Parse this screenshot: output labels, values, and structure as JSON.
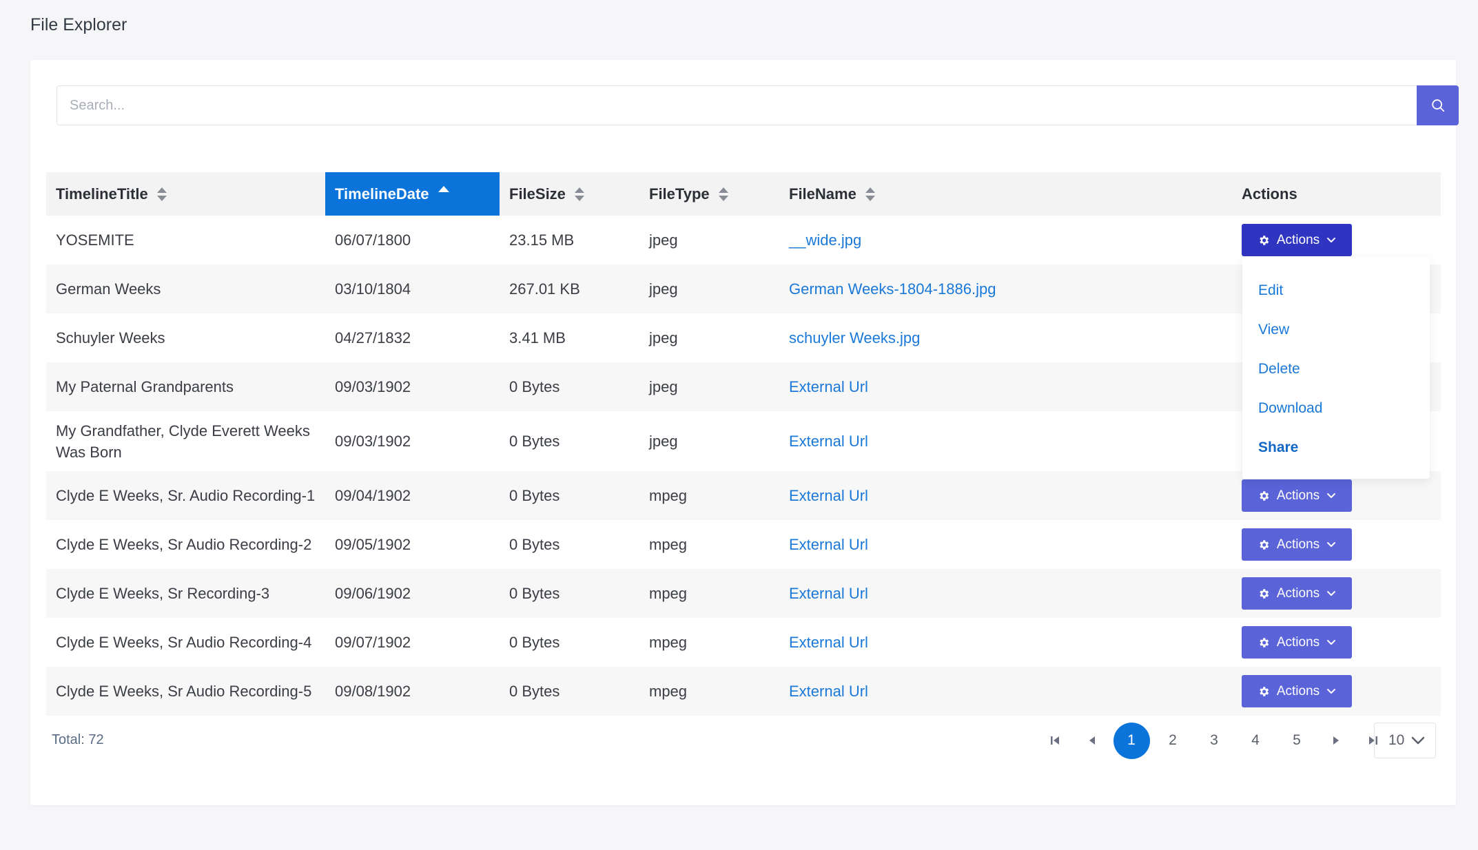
{
  "page": {
    "title": "File Explorer"
  },
  "search": {
    "placeholder": "Search..."
  },
  "table": {
    "columns": [
      {
        "label": "TimelineTitle",
        "sortable": true,
        "sort": "none"
      },
      {
        "label": "TimelineDate",
        "sortable": true,
        "sort": "asc"
      },
      {
        "label": "FileSize",
        "sortable": true,
        "sort": "none"
      },
      {
        "label": "FileType",
        "sortable": true,
        "sort": "none"
      },
      {
        "label": "FileName",
        "sortable": true,
        "sort": "none"
      },
      {
        "label": "Actions",
        "sortable": false,
        "sort": "none"
      }
    ],
    "action_label": "Actions",
    "rows": [
      {
        "title": "YOSEMITE",
        "date": "06/07/1800",
        "size": "23.15 MB",
        "type": "jpeg",
        "filename": "__wide.jpg"
      },
      {
        "title": "German Weeks",
        "date": "03/10/1804",
        "size": "267.01 KB",
        "type": "jpeg",
        "filename": "German Weeks-1804-1886.jpg"
      },
      {
        "title": "Schuyler Weeks",
        "date": "04/27/1832",
        "size": "3.41 MB",
        "type": "jpeg",
        "filename": "schuyler Weeks.jpg"
      },
      {
        "title": "My Paternal Grandparents",
        "date": "09/03/1902",
        "size": "0 Bytes",
        "type": "jpeg",
        "filename": "External Url"
      },
      {
        "title": "My Grandfather, Clyde Everett Weeks Was Born",
        "date": "09/03/1902",
        "size": "0 Bytes",
        "type": "jpeg",
        "filename": "External Url"
      },
      {
        "title": "Clyde E Weeks, Sr. Audio Recording-1",
        "date": "09/04/1902",
        "size": "0 Bytes",
        "type": "mpeg",
        "filename": "External Url"
      },
      {
        "title": "Clyde E Weeks, Sr Audio Recording-2",
        "date": "09/05/1902",
        "size": "0 Bytes",
        "type": "mpeg",
        "filename": "External Url"
      },
      {
        "title": "Clyde E Weeks, Sr Recording-3",
        "date": "09/06/1902",
        "size": "0 Bytes",
        "type": "mpeg",
        "filename": "External Url"
      },
      {
        "title": "Clyde E Weeks, Sr Audio Recording-4",
        "date": "09/07/1902",
        "size": "0 Bytes",
        "type": "mpeg",
        "filename": "External Url"
      },
      {
        "title": "Clyde E Weeks, Sr Audio Recording-5",
        "date": "09/08/1902",
        "size": "0 Bytes",
        "type": "mpeg",
        "filename": "External Url"
      }
    ]
  },
  "dropdown": {
    "items": [
      "Edit",
      "View",
      "Delete",
      "Download",
      "Share"
    ]
  },
  "footer": {
    "total": "Total: 72",
    "pages": [
      "1",
      "2",
      "3",
      "4",
      "5"
    ],
    "current_page": "1",
    "page_size": "10"
  },
  "colors": {
    "primary_button": "#5a63d8",
    "active_button": "#2f35c0",
    "active_header": "#0a74da",
    "link": "#1a78d8"
  },
  "icons": {
    "search": "search-icon",
    "sort": "sort-icon",
    "gear": "gear-icon",
    "chevron": "chevron-down-icon",
    "first": "first-page-icon",
    "prev": "prev-page-icon",
    "next": "next-page-icon",
    "last": "last-page-icon"
  }
}
